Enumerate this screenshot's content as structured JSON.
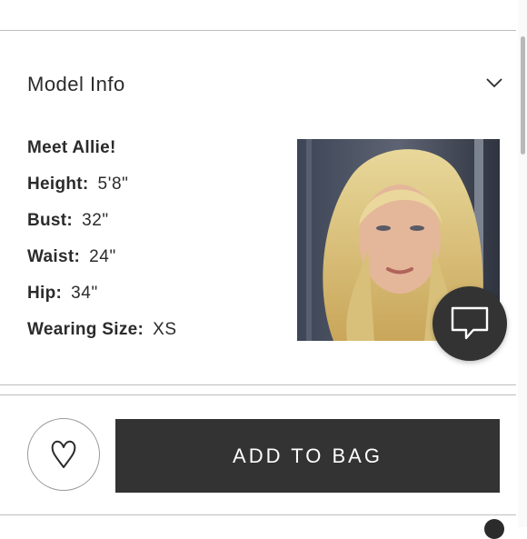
{
  "model_info": {
    "title": "Model Info",
    "intro": "Meet Allie!",
    "stats": [
      {
        "label": "Height:",
        "value": "5'8\""
      },
      {
        "label": "Bust:",
        "value": "32\""
      },
      {
        "label": "Waist:",
        "value": "24\""
      },
      {
        "label": "Hip:",
        "value": "34\""
      },
      {
        "label": "Wearing Size:",
        "value": "XS"
      }
    ]
  },
  "actions": {
    "add_to_bag_label": "ADD TO BAG"
  },
  "icons": {
    "expand": "chevron-down-icon",
    "chat": "chat-bubble-icon",
    "wishlist": "heart-icon"
  },
  "colors": {
    "button_dark": "#333333",
    "divider": "#bdbdbd",
    "text": "#2b2b2b"
  }
}
